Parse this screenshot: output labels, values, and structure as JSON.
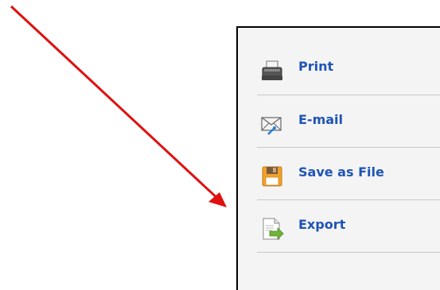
{
  "menu": {
    "items": [
      {
        "label": "Print",
        "icon": "printer-icon"
      },
      {
        "label": "E-mail",
        "icon": "email-icon"
      },
      {
        "label": "Save as File",
        "icon": "floppy-disk-icon"
      },
      {
        "label": "Export",
        "icon": "export-icon"
      }
    ]
  },
  "colors": {
    "link": "#1f54b6",
    "arrow": "#e01010",
    "panel": "#f4f4f4"
  }
}
